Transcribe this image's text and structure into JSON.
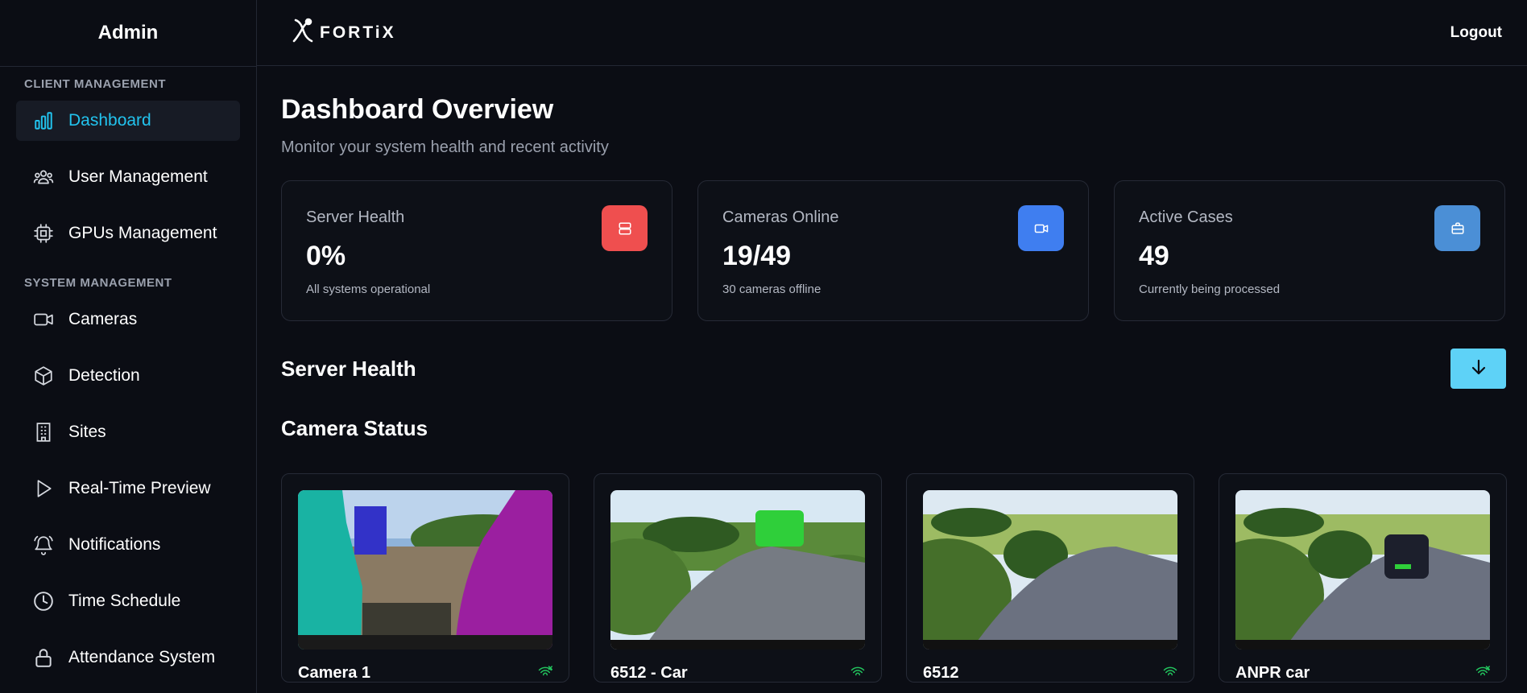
{
  "sidebar": {
    "title": "Admin",
    "section_client": "CLIENT MANAGEMENT",
    "section_system": "SYSTEM MANAGEMENT",
    "client_items": [
      {
        "label": "Dashboard",
        "icon": "bar-chart-icon",
        "active": true
      },
      {
        "label": "User Management",
        "icon": "users-icon"
      },
      {
        "label": "GPUs Management",
        "icon": "cpu-icon"
      }
    ],
    "system_items": [
      {
        "label": "Cameras",
        "icon": "video-icon"
      },
      {
        "label": "Detection",
        "icon": "cube-icon"
      },
      {
        "label": "Sites",
        "icon": "building-icon"
      },
      {
        "label": "Real-Time Preview",
        "icon": "play-icon"
      },
      {
        "label": "Notifications",
        "icon": "bell-icon"
      },
      {
        "label": "Time Schedule",
        "icon": "clock-icon"
      },
      {
        "label": "Attendance System",
        "icon": "lock-icon"
      }
    ]
  },
  "header": {
    "brand": "FORTiX",
    "logout": "Logout"
  },
  "page": {
    "title": "Dashboard Overview",
    "subtitle": "Monitor your system health and recent activity"
  },
  "stats": [
    {
      "title": "Server Health",
      "value": "0%",
      "sub": "All systems operational",
      "icon": "server-icon",
      "color": "#ef4f4f"
    },
    {
      "title": "Cameras Online",
      "value": "19/49",
      "sub": "30 cameras offline",
      "icon": "video-icon",
      "color": "#3f7ef0"
    },
    {
      "title": "Active Cases",
      "value": "49",
      "sub": "Currently being processed",
      "icon": "briefcase-icon",
      "color": "#4b8fd6"
    }
  ],
  "sections": {
    "server_health": "Server Health",
    "camera_status": "Camera Status"
  },
  "cameras": [
    {
      "name": "Camera 1",
      "icon": "wifi-off-icon"
    },
    {
      "name": "6512 - Car",
      "icon": "wifi-icon"
    },
    {
      "name": "6512",
      "icon": "wifi-icon"
    },
    {
      "name": "ANPR car",
      "icon": "wifi-off-icon"
    }
  ],
  "colors": {
    "accent": "#22c3ee",
    "download_button": "#5ed2f7",
    "signal": "#22c55e"
  }
}
